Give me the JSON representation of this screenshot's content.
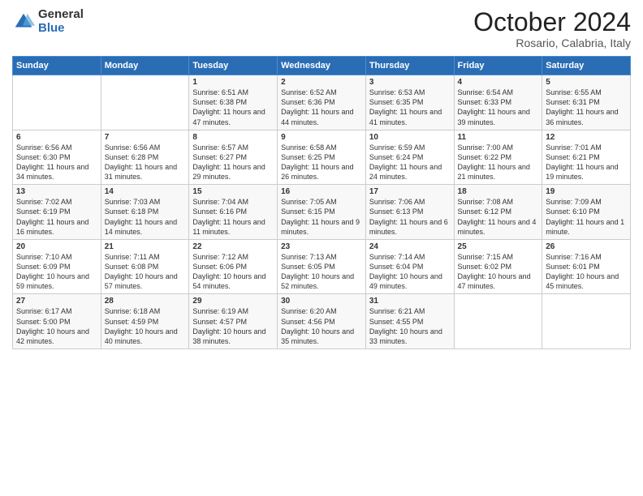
{
  "logo": {
    "general": "General",
    "blue": "Blue"
  },
  "header": {
    "month": "October 2024",
    "location": "Rosario, Calabria, Italy"
  },
  "days_of_week": [
    "Sunday",
    "Monday",
    "Tuesday",
    "Wednesday",
    "Thursday",
    "Friday",
    "Saturday"
  ],
  "weeks": [
    [
      {
        "day": "",
        "sunrise": "",
        "sunset": "",
        "daylight": ""
      },
      {
        "day": "",
        "sunrise": "",
        "sunset": "",
        "daylight": ""
      },
      {
        "day": "1",
        "sunrise": "Sunrise: 6:51 AM",
        "sunset": "Sunset: 6:38 PM",
        "daylight": "Daylight: 11 hours and 47 minutes."
      },
      {
        "day": "2",
        "sunrise": "Sunrise: 6:52 AM",
        "sunset": "Sunset: 6:36 PM",
        "daylight": "Daylight: 11 hours and 44 minutes."
      },
      {
        "day": "3",
        "sunrise": "Sunrise: 6:53 AM",
        "sunset": "Sunset: 6:35 PM",
        "daylight": "Daylight: 11 hours and 41 minutes."
      },
      {
        "day": "4",
        "sunrise": "Sunrise: 6:54 AM",
        "sunset": "Sunset: 6:33 PM",
        "daylight": "Daylight: 11 hours and 39 minutes."
      },
      {
        "day": "5",
        "sunrise": "Sunrise: 6:55 AM",
        "sunset": "Sunset: 6:31 PM",
        "daylight": "Daylight: 11 hours and 36 minutes."
      }
    ],
    [
      {
        "day": "6",
        "sunrise": "Sunrise: 6:56 AM",
        "sunset": "Sunset: 6:30 PM",
        "daylight": "Daylight: 11 hours and 34 minutes."
      },
      {
        "day": "7",
        "sunrise": "Sunrise: 6:56 AM",
        "sunset": "Sunset: 6:28 PM",
        "daylight": "Daylight: 11 hours and 31 minutes."
      },
      {
        "day": "8",
        "sunrise": "Sunrise: 6:57 AM",
        "sunset": "Sunset: 6:27 PM",
        "daylight": "Daylight: 11 hours and 29 minutes."
      },
      {
        "day": "9",
        "sunrise": "Sunrise: 6:58 AM",
        "sunset": "Sunset: 6:25 PM",
        "daylight": "Daylight: 11 hours and 26 minutes."
      },
      {
        "day": "10",
        "sunrise": "Sunrise: 6:59 AM",
        "sunset": "Sunset: 6:24 PM",
        "daylight": "Daylight: 11 hours and 24 minutes."
      },
      {
        "day": "11",
        "sunrise": "Sunrise: 7:00 AM",
        "sunset": "Sunset: 6:22 PM",
        "daylight": "Daylight: 11 hours and 21 minutes."
      },
      {
        "day": "12",
        "sunrise": "Sunrise: 7:01 AM",
        "sunset": "Sunset: 6:21 PM",
        "daylight": "Daylight: 11 hours and 19 minutes."
      }
    ],
    [
      {
        "day": "13",
        "sunrise": "Sunrise: 7:02 AM",
        "sunset": "Sunset: 6:19 PM",
        "daylight": "Daylight: 11 hours and 16 minutes."
      },
      {
        "day": "14",
        "sunrise": "Sunrise: 7:03 AM",
        "sunset": "Sunset: 6:18 PM",
        "daylight": "Daylight: 11 hours and 14 minutes."
      },
      {
        "day": "15",
        "sunrise": "Sunrise: 7:04 AM",
        "sunset": "Sunset: 6:16 PM",
        "daylight": "Daylight: 11 hours and 11 minutes."
      },
      {
        "day": "16",
        "sunrise": "Sunrise: 7:05 AM",
        "sunset": "Sunset: 6:15 PM",
        "daylight": "Daylight: 11 hours and 9 minutes."
      },
      {
        "day": "17",
        "sunrise": "Sunrise: 7:06 AM",
        "sunset": "Sunset: 6:13 PM",
        "daylight": "Daylight: 11 hours and 6 minutes."
      },
      {
        "day": "18",
        "sunrise": "Sunrise: 7:08 AM",
        "sunset": "Sunset: 6:12 PM",
        "daylight": "Daylight: 11 hours and 4 minutes."
      },
      {
        "day": "19",
        "sunrise": "Sunrise: 7:09 AM",
        "sunset": "Sunset: 6:10 PM",
        "daylight": "Daylight: 11 hours and 1 minute."
      }
    ],
    [
      {
        "day": "20",
        "sunrise": "Sunrise: 7:10 AM",
        "sunset": "Sunset: 6:09 PM",
        "daylight": "Daylight: 10 hours and 59 minutes."
      },
      {
        "day": "21",
        "sunrise": "Sunrise: 7:11 AM",
        "sunset": "Sunset: 6:08 PM",
        "daylight": "Daylight: 10 hours and 57 minutes."
      },
      {
        "day": "22",
        "sunrise": "Sunrise: 7:12 AM",
        "sunset": "Sunset: 6:06 PM",
        "daylight": "Daylight: 10 hours and 54 minutes."
      },
      {
        "day": "23",
        "sunrise": "Sunrise: 7:13 AM",
        "sunset": "Sunset: 6:05 PM",
        "daylight": "Daylight: 10 hours and 52 minutes."
      },
      {
        "day": "24",
        "sunrise": "Sunrise: 7:14 AM",
        "sunset": "Sunset: 6:04 PM",
        "daylight": "Daylight: 10 hours and 49 minutes."
      },
      {
        "day": "25",
        "sunrise": "Sunrise: 7:15 AM",
        "sunset": "Sunset: 6:02 PM",
        "daylight": "Daylight: 10 hours and 47 minutes."
      },
      {
        "day": "26",
        "sunrise": "Sunrise: 7:16 AM",
        "sunset": "Sunset: 6:01 PM",
        "daylight": "Daylight: 10 hours and 45 minutes."
      }
    ],
    [
      {
        "day": "27",
        "sunrise": "Sunrise: 6:17 AM",
        "sunset": "Sunset: 5:00 PM",
        "daylight": "Daylight: 10 hours and 42 minutes."
      },
      {
        "day": "28",
        "sunrise": "Sunrise: 6:18 AM",
        "sunset": "Sunset: 4:59 PM",
        "daylight": "Daylight: 10 hours and 40 minutes."
      },
      {
        "day": "29",
        "sunrise": "Sunrise: 6:19 AM",
        "sunset": "Sunset: 4:57 PM",
        "daylight": "Daylight: 10 hours and 38 minutes."
      },
      {
        "day": "30",
        "sunrise": "Sunrise: 6:20 AM",
        "sunset": "Sunset: 4:56 PM",
        "daylight": "Daylight: 10 hours and 35 minutes."
      },
      {
        "day": "31",
        "sunrise": "Sunrise: 6:21 AM",
        "sunset": "Sunset: 4:55 PM",
        "daylight": "Daylight: 10 hours and 33 minutes."
      },
      {
        "day": "",
        "sunrise": "",
        "sunset": "",
        "daylight": ""
      },
      {
        "day": "",
        "sunrise": "",
        "sunset": "",
        "daylight": ""
      }
    ]
  ]
}
